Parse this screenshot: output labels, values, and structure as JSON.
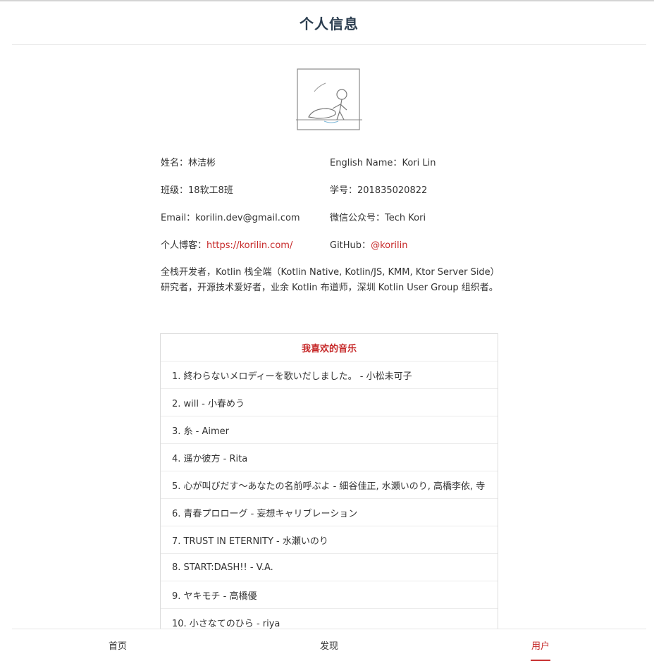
{
  "page": {
    "title": "个人信息"
  },
  "profile": {
    "name_label": "姓名：",
    "name_value": "林洁彬",
    "english_label": "English Name：",
    "english_value": "Kori Lin",
    "class_label": "班级：",
    "class_value": "18软工8班",
    "id_label": "学号：",
    "id_value": "201835020822",
    "email_label": "Email：",
    "email_value": "korilin.dev@gmail.com",
    "wechat_label": "微信公众号：",
    "wechat_value": "Tech Kori",
    "blog_label": "个人博客：",
    "blog_value": "https://korilin.com/",
    "github_label": "GitHub：",
    "github_value": "@korilin",
    "bio": "全栈开发者，Kotlin 栈全端（Kotlin Native, Kotlin/JS, KMM, Ktor Server Side）研究者，开源技术爱好者，业余 Kotlin 布道师，深圳 Kotlin User Group 组织者。"
  },
  "music": {
    "title": "我喜欢的音乐",
    "items": [
      "1. 終わらないメロディーを歌いだしました。 - 小松未可子",
      "2. will - 小春めう",
      "3. 糸 - Aimer",
      "4. 遥か彼方 - Rita",
      "5. 心が叫びだす～あなたの名前呼ぶよ - 細谷佳正, 水瀬いのり, 高橋李依, 寺",
      "6. 青春プロローグ - 妄想キャリブレーション",
      "7. TRUST IN ETERNITY - 水瀬いのり",
      "8. START:DASH!! - V.A.",
      "9. ヤキモチ - 高橋優",
      "10. 小さなてのひら - riya"
    ]
  },
  "tabbar": {
    "home": "首页",
    "discover": "发现",
    "user": "用户",
    "active_color": "#c62828"
  }
}
